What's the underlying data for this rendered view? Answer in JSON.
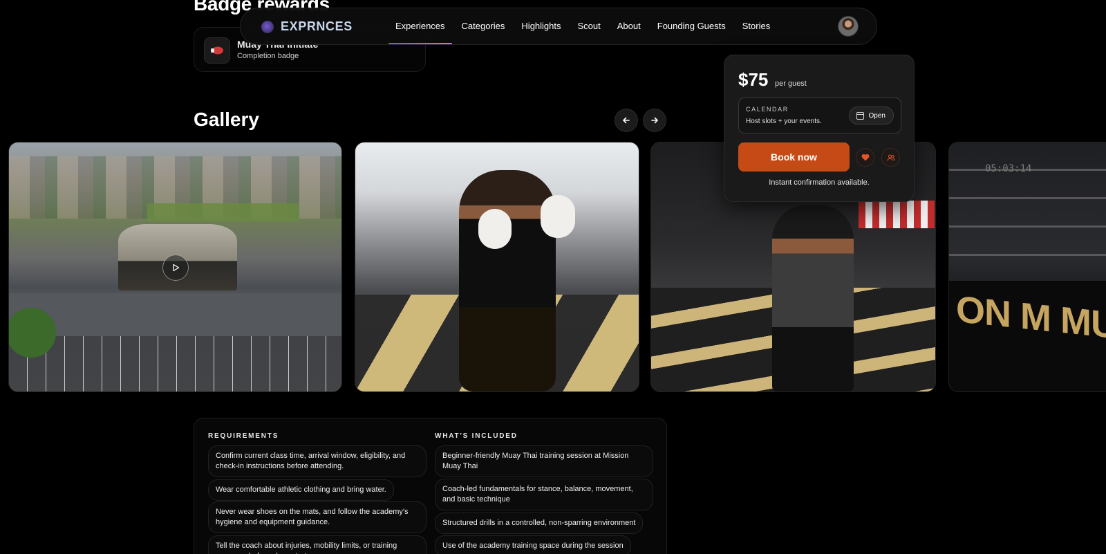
{
  "badge_rewards": {
    "heading": "Badge rewards",
    "badge": {
      "title": "Muay Thai Initiate",
      "subtitle": "Completion badge",
      "icon": "boxing-glove-icon"
    }
  },
  "nav": {
    "logo": "EXPRNCES",
    "links": [
      "Experiences",
      "Categories",
      "Highlights",
      "Scout",
      "About",
      "Founding Guests",
      "Stories"
    ],
    "active": "Experiences",
    "accent_gradient": [
      "#6b5bd6",
      "#b77ad9"
    ]
  },
  "gallery": {
    "title": "Gallery",
    "prev_icon": "arrow-left-icon",
    "next_icon": "arrow-right-icon",
    "images": [
      {
        "name": "aerial-view-of-gym",
        "has_video": true
      },
      {
        "name": "fighter-with-gloves"
      },
      {
        "name": "coach-wrapping-hands"
      },
      {
        "name": "boxing-ring",
        "ring_text": "ON M MUAY TH",
        "clock": "05:03:14"
      }
    ]
  },
  "booking": {
    "price": "$75",
    "price_unit": "per guest",
    "calendar_label": "CALENDAR",
    "calendar_sub": "Host slots + your events.",
    "open_label": "Open",
    "book_label": "Book now",
    "confirmation": "Instant confirmation available.",
    "accent": "#c64a15"
  },
  "requirements": {
    "title": "REQUIREMENTS",
    "items": [
      "Confirm current class time, arrival window, eligibility, and check-in instructions before attending.",
      "Wear comfortable athletic clothing and bring water.",
      "Never wear shoes on the mats, and follow the academy's hygiene and equipment guidance.",
      "Tell the coach about injuries, mobility limits, or training concerns before class starts."
    ]
  },
  "included": {
    "title": "WHAT'S INCLUDED",
    "items": [
      "Beginner-friendly Muay Thai training session at Mission Muay Thai",
      "Coach-led fundamentals for stance, balance, movement, and basic technique",
      "Structured drills in a controlled, non-sparring environment",
      "Use of the academy training space during the session"
    ]
  }
}
